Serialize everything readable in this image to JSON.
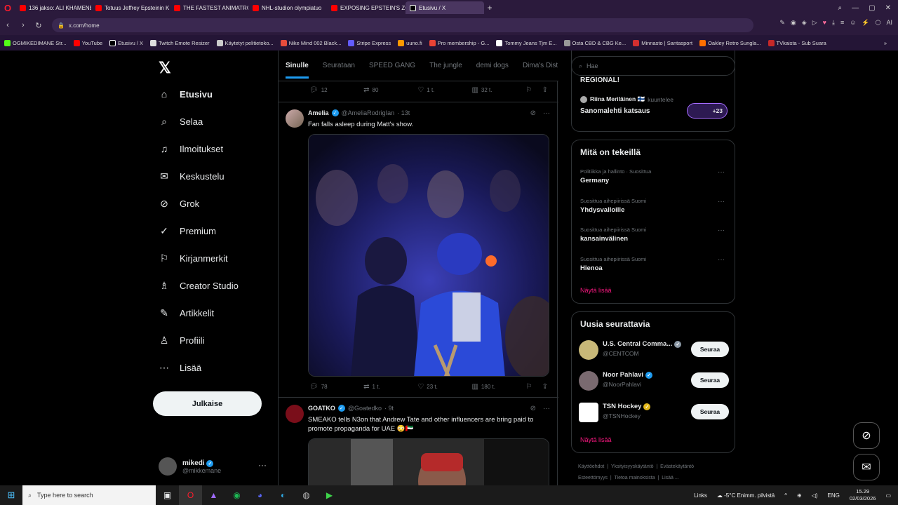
{
  "browser": {
    "tabs": [
      {
        "title": "136 jakso: ALI KHAMENEI"
      },
      {
        "title": "Totuus Jeffrey Epsteinin K"
      },
      {
        "title": "THE FASTEST ANIMATRON"
      },
      {
        "title": "NHL-studion olympiatuo"
      },
      {
        "title": "EXPOSING EPSTEIN'S ZOR"
      },
      {
        "title": "Etusivu / X"
      }
    ],
    "url": "x.com/home",
    "ai_label": "AI",
    "bookmarks": [
      "OGMIKEDIMANE Str...",
      "YouTube",
      "Etusivu / X",
      "Twitch Emote Resizer",
      "Käytetyt pelitietoko...",
      "Nike Mind 002 Black...",
      "Stripe Express",
      "uuno.fi",
      "Pro membership - G...",
      "Tommy Jeans Tjm E...",
      "Osta CBD & CBG Ke...",
      "Minnasto | Santasport",
      "Oakley Retro Sungla...",
      "TVkaista - Sub Suara"
    ]
  },
  "nav": {
    "items": [
      {
        "label": "Etusivu",
        "icon": "home-icon"
      },
      {
        "label": "Selaa",
        "icon": "search-icon"
      },
      {
        "label": "Ilmoitukset",
        "icon": "bell-icon"
      },
      {
        "label": "Keskustelu",
        "icon": "mail-icon"
      },
      {
        "label": "Grok",
        "icon": "grok-icon"
      },
      {
        "label": "Premium",
        "icon": "premium-icon"
      },
      {
        "label": "Kirjanmerkit",
        "icon": "bookmark-icon"
      },
      {
        "label": "Creator Studio",
        "icon": "creator-icon"
      },
      {
        "label": "Artikkelit",
        "icon": "article-icon"
      },
      {
        "label": "Profiili",
        "icon": "profile-icon"
      },
      {
        "label": "Lisää",
        "icon": "more-icon"
      }
    ],
    "post_label": "Julkaise",
    "account": {
      "name": "mikedi",
      "handle": "@mikkemane"
    }
  },
  "feed": {
    "tabs": [
      "Sinulle",
      "Seurataan",
      "SPEED GANG",
      "The jungle",
      "demi dogs",
      "Dima's Dist"
    ],
    "prev_actions": {
      "replies": "12",
      "reposts": "80",
      "likes": "1 t.",
      "views": "32 t."
    },
    "posts": [
      {
        "name": "Amelia",
        "handle": "@AmeliaRodrigIan",
        "time": "13t",
        "text": "Fan falls asleep during Matt's show.",
        "actions": {
          "replies": "78",
          "reposts": "1 t.",
          "likes": "23 t.",
          "views": "180 t."
        }
      },
      {
        "name": "GOATKO",
        "handle": "@Goatedko",
        "time": "9t",
        "text": "SMEAKO tells N3on that Andrew Tate and other influencers are bring paid to promote propaganda for UAE 😳🇦🇪"
      }
    ]
  },
  "right": {
    "search_placeholder": "Hae",
    "spaces": {
      "title_partial": "REGIONAL!",
      "host": "Riina Meriläinen 🇫🇮",
      "host_status": "kuuntelee",
      "space_title": "Sanomalehti katsaus",
      "listeners": "+23"
    },
    "trends": {
      "title": "Mitä on tekeillä",
      "items": [
        {
          "meta": "Politiikka ja hallinto · Suosittua",
          "name": "Germany"
        },
        {
          "meta": "Suosittua aihepiirissä Suomi",
          "name": "Yhdysvalloille"
        },
        {
          "meta": "Suosittua aihepiirissä Suomi",
          "name": "kansainvälinen"
        },
        {
          "meta": "Suosittua aihepiirissä Suomi",
          "name": "Hienoa"
        }
      ],
      "show_more": "Näytä lisää"
    },
    "who_to_follow": {
      "title": "Uusia seurattavia",
      "items": [
        {
          "name": "U.S. Central Comma...",
          "handle": "@CENTCOM",
          "button": "Seuraa"
        },
        {
          "name": "Noor Pahlavi",
          "handle": "@NoorPahlavi",
          "button": "Seuraa"
        },
        {
          "name": "TSN Hockey",
          "handle": "@TSNHockey",
          "button": "Seuraa"
        }
      ],
      "show_more": "Näytä lisää"
    },
    "footer": [
      "Käyttöehdot",
      "Yksityisyyskäytäntö",
      "Evästekäytäntö",
      "Esteettömyys",
      "Tietoa mainoksista",
      "Lisää ..."
    ]
  },
  "taskbar": {
    "search_placeholder": "Type here to search",
    "links": "Links",
    "weather": "-5°C  Enimm. pilvistä",
    "lang": "ENG",
    "time": "15.29",
    "date": "02/03/2026"
  }
}
